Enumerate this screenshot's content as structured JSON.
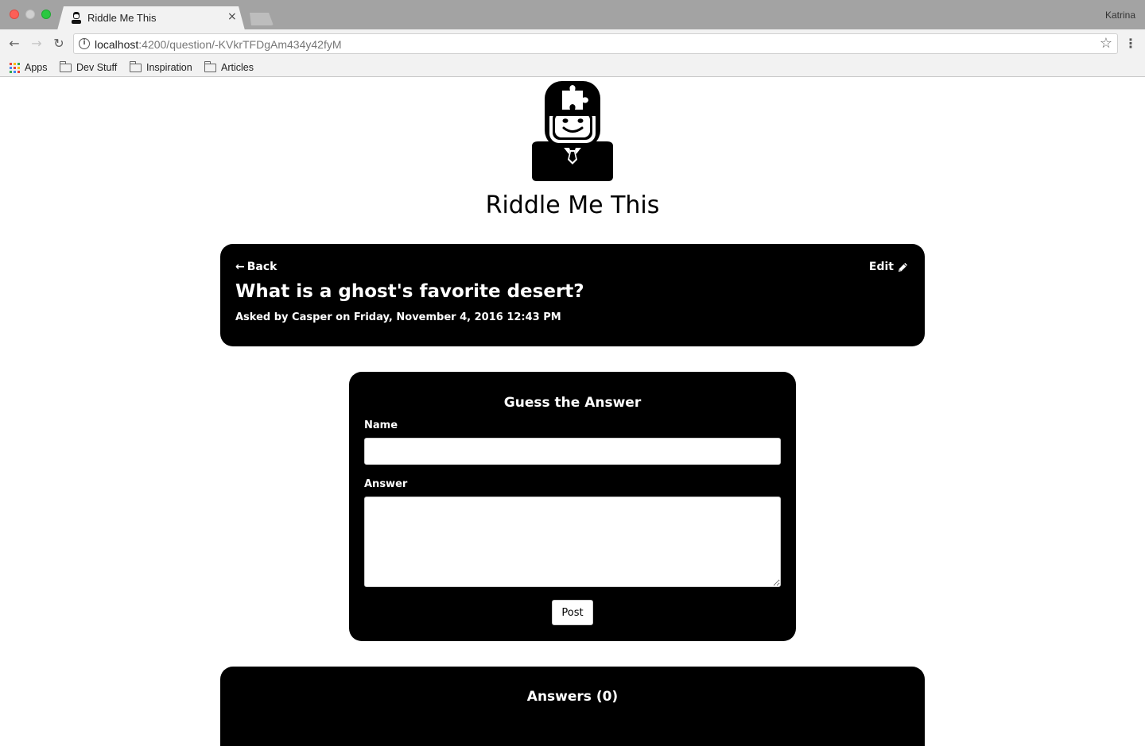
{
  "browser": {
    "tab_title": "Riddle Me This",
    "tab_close": "×",
    "profile_name": "Katrina",
    "url_host": "localhost",
    "url_rest": ":4200/question/-KVkrTFDgAm434y42fyM",
    "nav_back": "←",
    "nav_forward": "→",
    "nav_reload": "↻",
    "info_glyph": "i",
    "star_glyph": "☆",
    "menu_glyph": "⋮",
    "bookmarks": [
      {
        "label": "Apps",
        "icon": "apps-grid-icon"
      },
      {
        "label": "Dev Stuff",
        "icon": "folder-icon"
      },
      {
        "label": "Inspiration",
        "icon": "folder-icon"
      },
      {
        "label": "Articles",
        "icon": "folder-icon"
      }
    ]
  },
  "site": {
    "title": "Riddle Me This",
    "logo_icon": "riddler-puzzle-head-icon"
  },
  "question": {
    "back_label": "Back",
    "back_arrow": "←",
    "edit_label": "Edit",
    "edit_icon": "pencil-icon",
    "title": "What is a ghost's favorite desert?",
    "meta": "Asked by Casper on Friday, November 4, 2016 12:43 PM"
  },
  "answer_form": {
    "title": "Guess the Answer",
    "name_label": "Name",
    "name_value": "",
    "answer_label": "Answer",
    "answer_value": "",
    "post_label": "Post"
  },
  "answers": {
    "title": "Answers (0)"
  },
  "colors": {
    "card_background": "#000000",
    "page_background": "#ffffff",
    "chrome_background": "#f2f2f2"
  }
}
